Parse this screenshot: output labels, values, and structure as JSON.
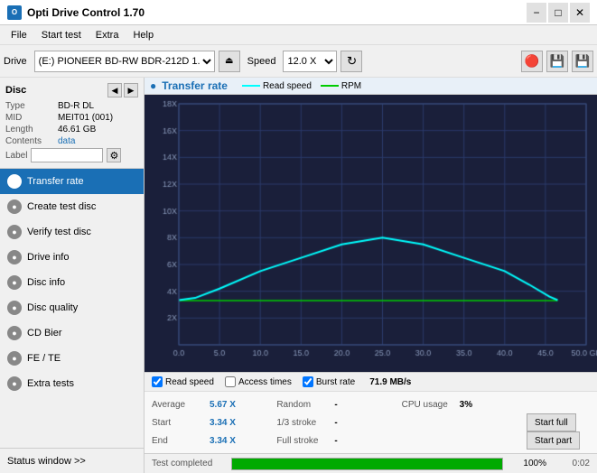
{
  "titleBar": {
    "title": "Opti Drive Control 1.70",
    "minimizeLabel": "−",
    "maximizeLabel": "□",
    "closeLabel": "✕"
  },
  "menuBar": {
    "items": [
      "File",
      "Start test",
      "Extra",
      "Help"
    ]
  },
  "toolbar": {
    "driveLabel": "Drive",
    "driveValue": "(E:) PIONEER BD-RW  BDR-212D 1.00",
    "speedLabel": "Speed",
    "speedValue": "12.0 X"
  },
  "disc": {
    "title": "Disc",
    "fields": [
      {
        "label": "Type",
        "value": "BD-R DL",
        "blue": false
      },
      {
        "label": "MID",
        "value": "MEIT01 (001)",
        "blue": false
      },
      {
        "label": "Length",
        "value": "46.61 GB",
        "blue": false
      },
      {
        "label": "Contents",
        "value": "data",
        "blue": true
      }
    ],
    "labelField": "Label",
    "labelPlaceholder": ""
  },
  "navItems": [
    {
      "id": "transfer-rate",
      "label": "Transfer rate",
      "active": true
    },
    {
      "id": "create-test-disc",
      "label": "Create test disc",
      "active": false
    },
    {
      "id": "verify-test-disc",
      "label": "Verify test disc",
      "active": false
    },
    {
      "id": "drive-info",
      "label": "Drive info",
      "active": false
    },
    {
      "id": "disc-info",
      "label": "Disc info",
      "active": false
    },
    {
      "id": "disc-quality",
      "label": "Disc quality",
      "active": false
    },
    {
      "id": "cd-bier",
      "label": "CD Bier",
      "active": false
    },
    {
      "id": "fe-te",
      "label": "FE / TE",
      "active": false
    },
    {
      "id": "extra-tests",
      "label": "Extra tests",
      "active": false
    }
  ],
  "statusWindow": {
    "label": "Status window >>"
  },
  "chart": {
    "title": "Transfer rate",
    "icon": "●",
    "legend": [
      {
        "label": "Read speed",
        "color": "cyan"
      },
      {
        "label": "RPM",
        "color": "green"
      }
    ],
    "yAxisLabels": [
      "18X",
      "16X",
      "14X",
      "12X",
      "10X",
      "8X",
      "6X",
      "4X",
      "2X",
      "0.0"
    ],
    "xAxisLabels": [
      "0.0",
      "5.0",
      "10.0",
      "15.0",
      "20.0",
      "25.0",
      "30.0",
      "35.0",
      "40.0",
      "45.0",
      "50.0 GB"
    ]
  },
  "checkboxes": [
    {
      "id": "read-speed",
      "label": "Read speed",
      "checked": true
    },
    {
      "id": "access-times",
      "label": "Access times",
      "checked": false
    },
    {
      "id": "burst-rate",
      "label": "Burst rate",
      "checked": true
    }
  ],
  "burstRate": "71.9 MB/s",
  "stats": {
    "rows": [
      {
        "cols": [
          {
            "label": "Average",
            "value": "5.67 X",
            "blue": true
          },
          {
            "label": "Random",
            "value": "-",
            "blue": false
          },
          {
            "label": "CPU usage",
            "value": "3%",
            "blue": false
          },
          {
            "button": null
          }
        ]
      },
      {
        "cols": [
          {
            "label": "Start",
            "value": "3.34 X",
            "blue": true
          },
          {
            "label": "1/3 stroke",
            "value": "-",
            "blue": false
          },
          {
            "label": "",
            "value": "",
            "blue": false
          },
          {
            "button": "Start full"
          }
        ]
      },
      {
        "cols": [
          {
            "label": "End",
            "value": "3.34 X",
            "blue": true
          },
          {
            "label": "Full stroke",
            "value": "-",
            "blue": false
          },
          {
            "label": "",
            "value": "",
            "blue": false
          },
          {
            "button": "Start part"
          }
        ]
      }
    ]
  },
  "progress": {
    "statusText": "Test completed",
    "percentage": 100,
    "time": "0:02"
  }
}
